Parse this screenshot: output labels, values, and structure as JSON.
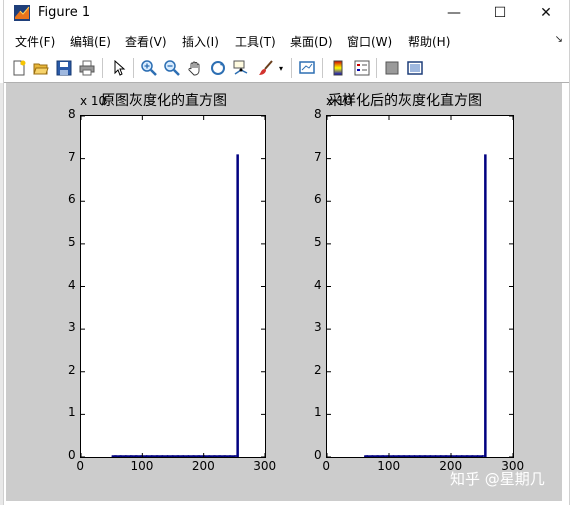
{
  "window": {
    "title": "Figure 1",
    "controls": {
      "minimize": "—",
      "maximize": "☐",
      "close": "✕"
    }
  },
  "menu": {
    "items": [
      "文件(F)",
      "编辑(E)",
      "查看(V)",
      "插入(I)",
      "工具(T)",
      "桌面(D)",
      "窗口(W)",
      "帮助(H)"
    ]
  },
  "toolbar": {
    "icons": [
      "new-figure-icon",
      "open-file-icon",
      "save-icon",
      "print-icon",
      "pointer-icon",
      "zoom-in-icon",
      "zoom-out-icon",
      "pan-hand-icon",
      "rotate-3d-icon",
      "data-cursor-icon",
      "brush-icon",
      "link-plot-icon",
      "colorbar-icon",
      "legend-icon",
      "hide-plot-tools-icon",
      "show-plot-tools-icon"
    ]
  },
  "chart_data": [
    {
      "type": "bar",
      "title": "原图灰度化的直方图",
      "xlim": [
        0,
        300
      ],
      "ylim": [
        0,
        8
      ],
      "xticks": [
        "0",
        "100",
        "200",
        "300"
      ],
      "yticks": [
        "0",
        "1",
        "2",
        "3",
        "4",
        "5",
        "6",
        "7",
        "8"
      ],
      "y_exponent_label": "x 10",
      "bar_color": "#000080",
      "peak": {
        "x": 255,
        "y": 7.1
      },
      "baseline_range": [
        50,
        250
      ],
      "baseline_level": 0.03
    },
    {
      "type": "bar",
      "title": "采样化后的灰度化直方图",
      "xlim": [
        0,
        300
      ],
      "ylim": [
        0,
        8
      ],
      "xticks": [
        "0",
        "100",
        "200",
        "300"
      ],
      "yticks": [
        "0",
        "1",
        "2",
        "3",
        "4",
        "5",
        "6",
        "7",
        "8"
      ],
      "y_exponent_label": "x 10",
      "bar_color": "#000080",
      "peak": {
        "x": 255,
        "y": 7.1
      },
      "baseline_range": [
        60,
        250
      ],
      "baseline_level": 0.03
    }
  ],
  "watermark": "知乎 @星期几"
}
